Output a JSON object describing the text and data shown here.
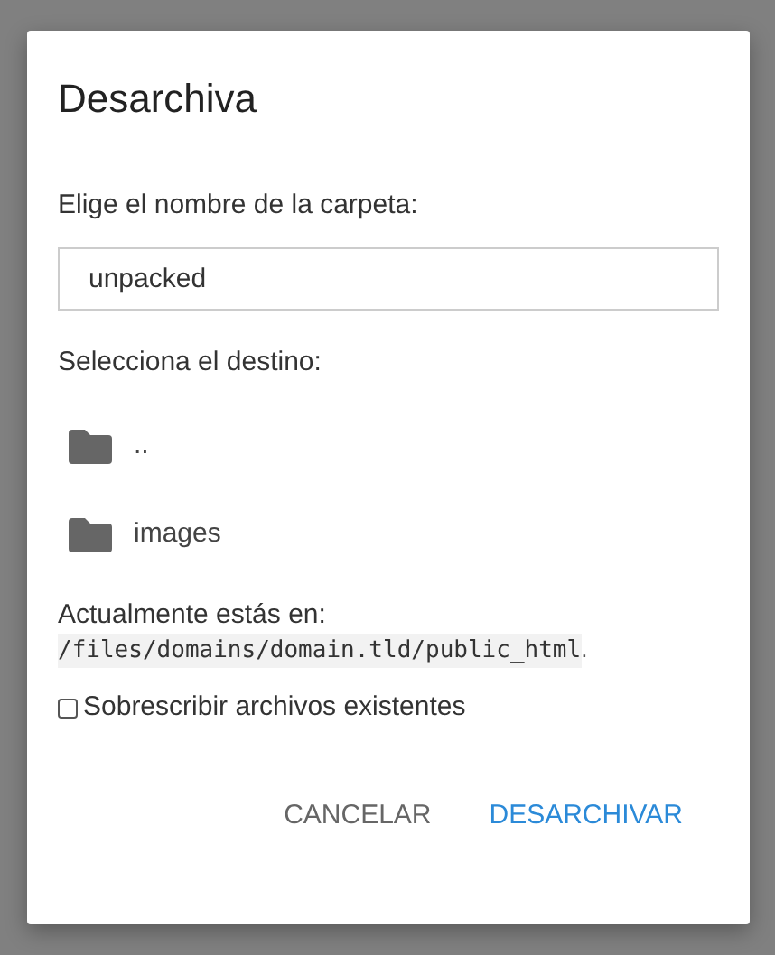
{
  "dialog": {
    "title": "Desarchiva",
    "name_label": "Elige el nombre de la carpeta:",
    "name_field": {
      "value": "unpacked"
    },
    "destination_label": "Selecciona el destino:",
    "folders": [
      {
        "name": ".."
      },
      {
        "name": "images"
      }
    ],
    "location": {
      "label": "Actualmente estás en:",
      "path": "/files/domains/domain.tld/public_html",
      "suffix": "."
    },
    "overwrite": {
      "label": "Sobrescribir archivos existentes",
      "checked": false
    },
    "buttons": [
      {
        "label": "CANCELAR",
        "kind": "secondary"
      },
      {
        "label": "DESARCHIVAR",
        "kind": "primary"
      }
    ]
  }
}
